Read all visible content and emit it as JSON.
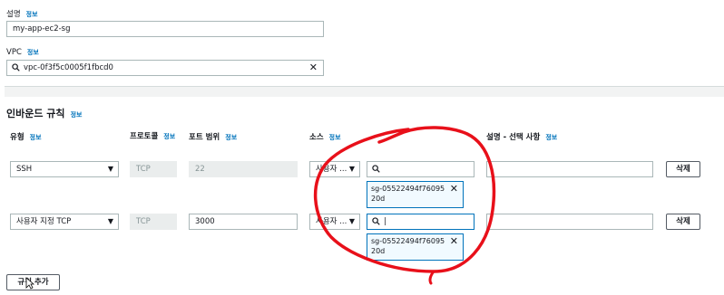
{
  "description": {
    "label": "설명",
    "info": "정보",
    "value": "my-app-ec2-sg"
  },
  "vpc": {
    "label": "VPC",
    "info": "정보",
    "value": "vpc-0f3f5c0005f1fbcd0"
  },
  "inbound": {
    "title": "인바운드 규칙",
    "info": "정보",
    "columns": {
      "type": "유형",
      "type_info": "정보",
      "protocol": "프로토콜",
      "protocol_info": "정보",
      "port": "포트 범위",
      "port_info": "정보",
      "source": "소스",
      "source_info": "정보",
      "desc": "설명 - 선택 사항",
      "desc_info": "정보"
    },
    "rules": [
      {
        "type": "SSH",
        "protocol": "TCP",
        "port": "22",
        "source": "사용자 ...",
        "search": "",
        "token": "sg-05522494f7609520d",
        "delete": "삭제"
      },
      {
        "type": "사용자 지정 TCP",
        "protocol": "TCP",
        "port": "3000",
        "source": "사용자 ...",
        "search": "|",
        "token": "sg-05522494f7609520d",
        "delete": "삭제"
      }
    ],
    "add_rule": "규칙 추가"
  },
  "annotation_color": "#e8101a"
}
